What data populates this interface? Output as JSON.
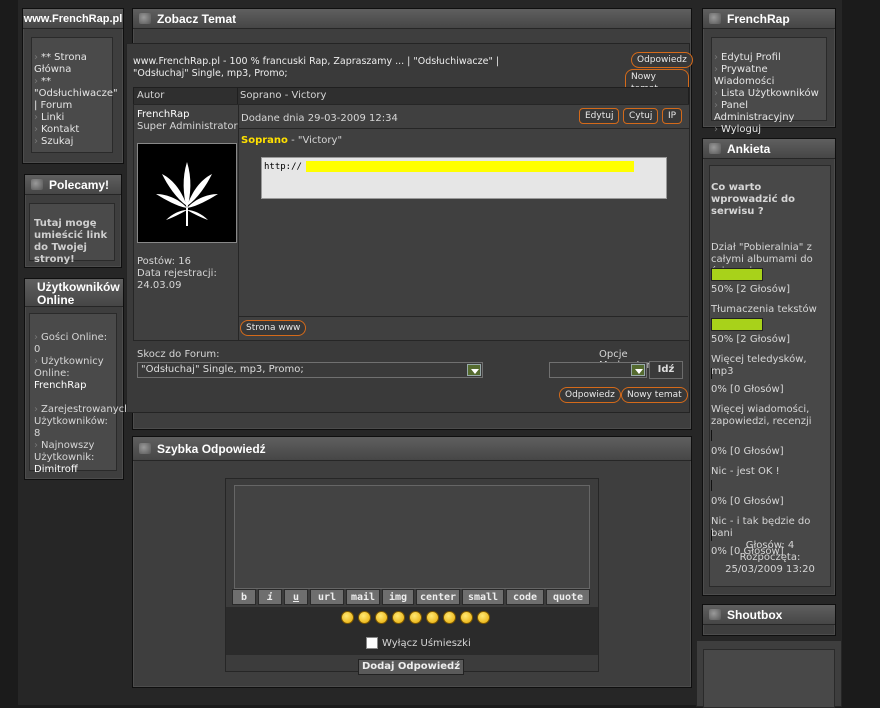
{
  "left": {
    "site_title": "www.FrenchRap.pl",
    "menu": [
      "** Strona Główna",
      "** \"Odsłuchiwacze\" | Forum",
      "Linki",
      "Kontakt",
      "Szukaj"
    ],
    "recommend_title": "Polecamy!",
    "recommend_text": "Tutaj mogę umieścić link do Twojej strony!",
    "users_title": "Użytkowników Online",
    "guests": "Gości Online: 0",
    "users_online_label": "Użytkownicy Online:",
    "users_online_name": "FrenchRap",
    "registered": "Zarejestrowanych Użytkowników: 8",
    "newest_label": "Najnowszy Użytkownik:",
    "newest_name": "Dimitroff"
  },
  "topic": {
    "title": "Zobacz Temat",
    "breadcrumb": "www.FrenchRap.pl - 100 % francuski Rap, Zapraszamy ... | \"Odsłuchiwacze\" | \"Odsłuchaj\" Single, mp3, Promo;",
    "reply_btn": "Odpowiedz",
    "new_topic_btn": "Nowy temat",
    "col_author": "Autor",
    "col_subject": "Soprano - Victory",
    "author_name": "FrenchRap",
    "author_rank": "Super Administrator",
    "posts": "Postów: 16",
    "reg_date": "Data rejestracji: 24.03.09",
    "post_date": "Dodane dnia 29-03-2009 12:34",
    "edit_btn": "Edytuj",
    "quote_btn": "Cytuj",
    "ip_btn": "IP",
    "post_artist": "Soprano",
    "post_rest": " - \"Victory\"",
    "code_text": "http://",
    "www_btn": "Strona www",
    "jump_label": "Skocz do Forum:",
    "jump_value": "\"Odsłuchaj\" Single, mp3, Promo;",
    "mod_label": "Opcje Moderatora:",
    "go_btn": "Idź"
  },
  "quick": {
    "title": "Szybka Odpowiedź",
    "toolbar": [
      "b",
      "i",
      "u",
      "url",
      "mail",
      "img",
      "center",
      "small",
      "code",
      "quote"
    ],
    "disable_smileys": "Wyłącz Uśmieszki",
    "submit": "Dodaj Odpowiedź"
  },
  "right": {
    "title": "FrenchRap",
    "menu": [
      "Edytuj Profil",
      "Prywatne Wiadomości",
      "Lista Użytkowników",
      "Panel Administracyjny",
      "Wyloguj"
    ],
    "poll_title": "Ankieta",
    "poll_question": "Co warto wprowadzić do serwisu ?",
    "options": [
      {
        "label": "Dział \"Pobieralnia\" z całymi albumami do ściągania",
        "result": "50% [2 Głosów]",
        "percent": 50
      },
      {
        "label": "Tłumaczenia tekstów",
        "result": "50% [2 Głosów]",
        "percent": 50
      },
      {
        "label": "Więcej teledysków, mp3",
        "result": "0% [0 Głosów]",
        "percent": 0
      },
      {
        "label": "Więcej wiadomości, zapowiedzi, recenzji",
        "result": "0% [0 Głosów]",
        "percent": 0
      },
      {
        "label": "Nic - jest OK !",
        "result": "0% [0 Głosów]",
        "percent": 0
      },
      {
        "label": "Nic - i tak będzie do bani",
        "result": "0% [0 Głosów]",
        "percent": 0
      }
    ],
    "votes": "Głosów: 4",
    "started": "Rozpoczęta: 25/03/2009 13:20",
    "shoutbox_title": "Shoutbox"
  }
}
